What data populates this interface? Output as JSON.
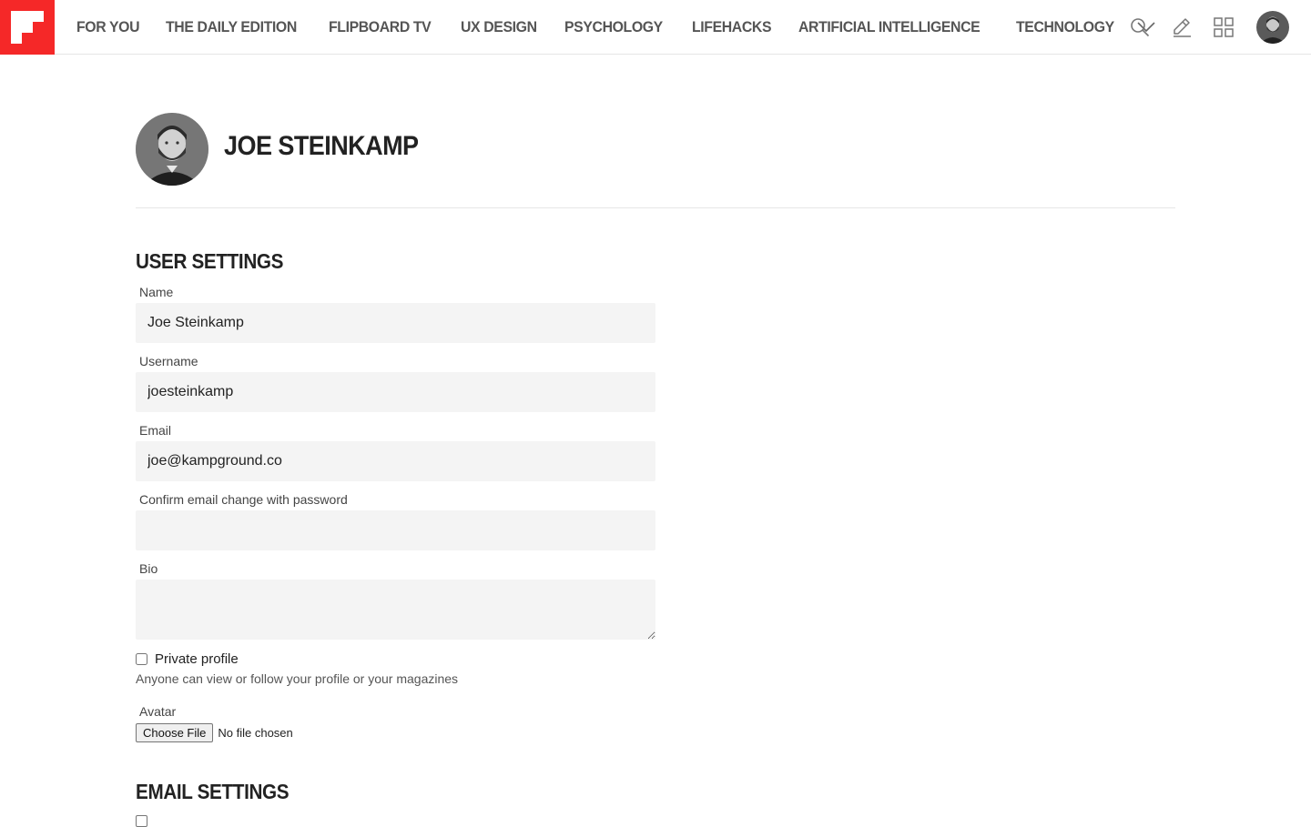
{
  "nav": {
    "items": [
      "FOR YOU",
      "THE DAILY EDITION",
      "FLIPBOARD TV",
      "UX DESIGN",
      "PSYCHOLOGY",
      "LIFEHACKS",
      "ARTIFICIAL INTELLIGENCE",
      "TECHNOLOGY"
    ],
    "more_icon": "chevron-down-icon"
  },
  "toolbar": {
    "icons": [
      "search-icon",
      "pencil-icon",
      "grid-icon",
      "avatar"
    ]
  },
  "brand": {
    "accent": "#f52828"
  },
  "profile": {
    "name": "JOE STEINKAMP"
  },
  "user_settings": {
    "title": "USER SETTINGS",
    "name_label": "Name",
    "name_value": "Joe Steinkamp",
    "username_label": "Username",
    "username_value": "joesteinkamp",
    "email_label": "Email",
    "email_value": "joe@kampground.co",
    "confirm_label": "Confirm email change with password",
    "confirm_value": "",
    "bio_label": "Bio",
    "bio_value": "",
    "private_label": "Private profile",
    "private_checked": false,
    "private_help": "Anyone can view or follow your profile or your magazines",
    "avatar_label": "Avatar",
    "file_button": "Choose File",
    "file_status": "No file chosen"
  },
  "email_settings": {
    "title": "EMAIL SETTINGS"
  }
}
